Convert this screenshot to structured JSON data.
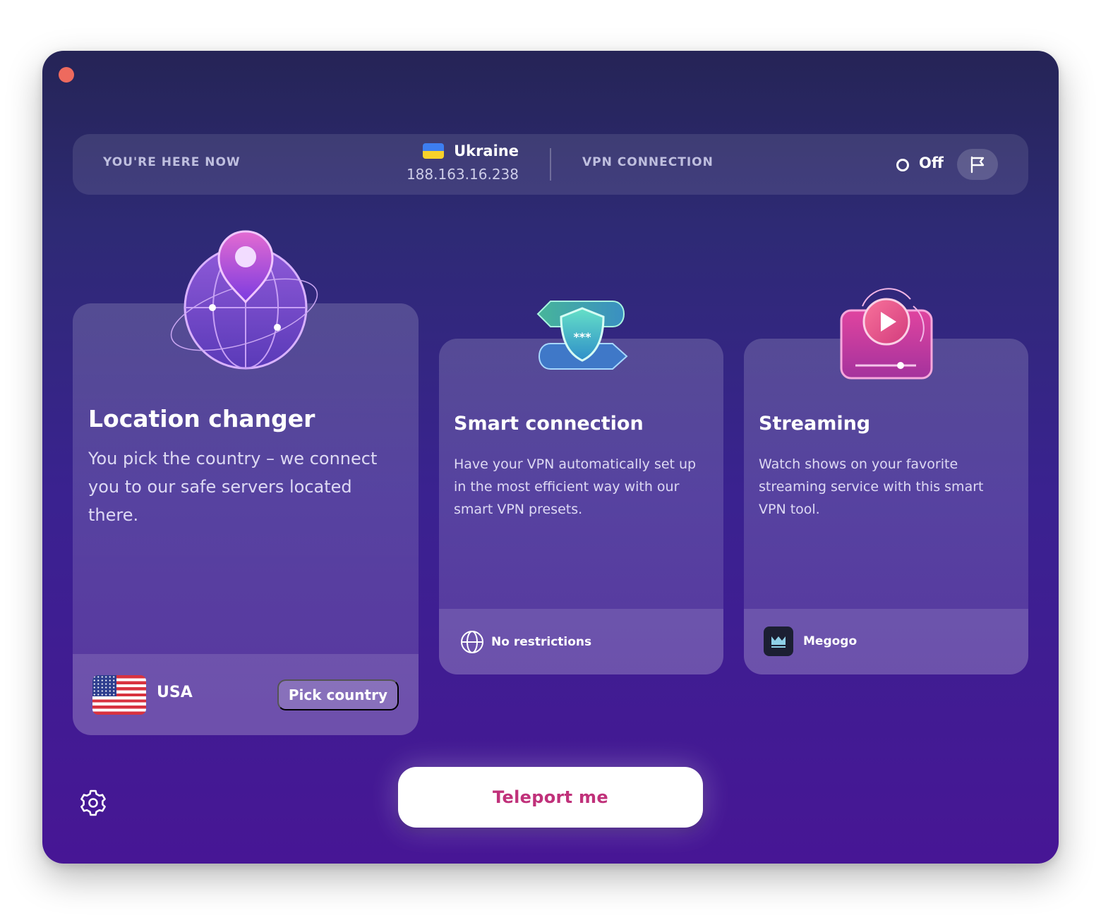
{
  "status": {
    "here_label": "YOU'RE HERE NOW",
    "country": "Ukraine",
    "ip": "188.163.16.238",
    "vpn_label": "VPN CONNECTION",
    "vpn_state": "Off"
  },
  "cards": [
    {
      "title": "Location changer",
      "description": "You pick the country – we connect you to our safe servers located there.",
      "footer_country": "USA",
      "footer_button": "Pick country",
      "icon": "globe-pin-icon"
    },
    {
      "title": "Smart connection",
      "description": "Have your VPN automatically set up in the most efficient way with our smart VPN presets.",
      "footer_label": "No restrictions",
      "icon": "shield-icon"
    },
    {
      "title": "Streaming",
      "description": "Watch shows on your favorite streaming service with this smart VPN tool.",
      "footer_label": "Megogo",
      "icon": "play-icon"
    }
  ],
  "primary_action": "Teleport me",
  "colors": {
    "background_top": "#252456",
    "background_bottom": "#471695",
    "accent": "#c0317a",
    "close_dot": "#ee6a5e"
  }
}
